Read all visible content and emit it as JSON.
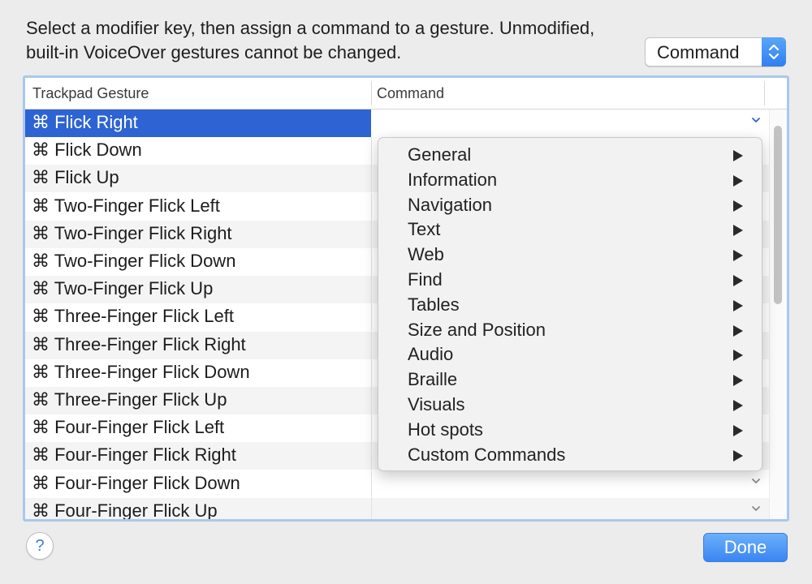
{
  "instructions": {
    "line1": "Select a modifier key, then assign a command to a gesture. Unmodified,",
    "line2": "built-in VoiceOver gestures cannot be changed."
  },
  "modifier_select": {
    "value": "Command"
  },
  "table": {
    "headers": {
      "gesture": "Trackpad Gesture",
      "command": "Command"
    },
    "rows": [
      {
        "gesture": "⌘ Flick Right",
        "selected": true
      },
      {
        "gesture": "⌘ Flick Down"
      },
      {
        "gesture": "⌘ Flick Up"
      },
      {
        "gesture": "⌘ Two-Finger Flick Left"
      },
      {
        "gesture": "⌘ Two-Finger Flick Right"
      },
      {
        "gesture": "⌘ Two-Finger Flick Down"
      },
      {
        "gesture": "⌘ Two-Finger Flick Up"
      },
      {
        "gesture": "⌘ Three-Finger Flick Left"
      },
      {
        "gesture": "⌘ Three-Finger Flick Right"
      },
      {
        "gesture": "⌘ Three-Finger Flick Down"
      },
      {
        "gesture": "⌘ Three-Finger Flick Up"
      },
      {
        "gesture": "⌘ Four-Finger Flick Left"
      },
      {
        "gesture": "⌘ Four-Finger Flick Right"
      },
      {
        "gesture": "⌘ Four-Finger Flick Down"
      },
      {
        "gesture": "⌘ Four-Finger Flick Up"
      }
    ]
  },
  "command_menu": {
    "items": [
      {
        "label": "General"
      },
      {
        "label": "Information"
      },
      {
        "label": "Navigation"
      },
      {
        "label": "Text"
      },
      {
        "label": "Web"
      },
      {
        "label": "Find"
      },
      {
        "label": "Tables"
      },
      {
        "label": "Size and Position"
      },
      {
        "label": "Audio"
      },
      {
        "label": "Braille"
      },
      {
        "label": "Visuals"
      },
      {
        "label": "Hot spots"
      },
      {
        "label": "Custom Commands"
      }
    ]
  },
  "footer": {
    "help_label": "?",
    "done_label": "Done"
  },
  "colors": {
    "selection": "#2d63d3",
    "accent_button": "#3a85f2",
    "focus_ring": "#a9c8f0"
  }
}
